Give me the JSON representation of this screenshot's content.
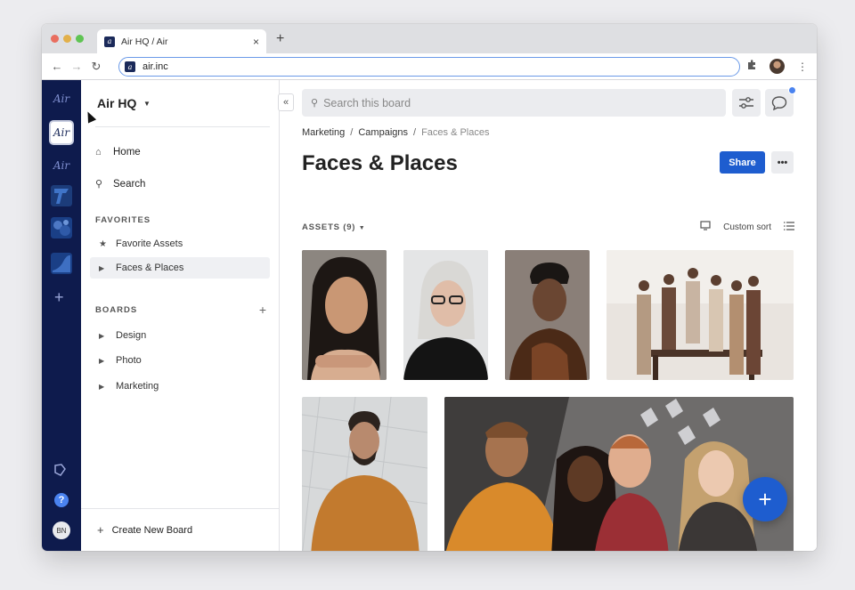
{
  "browser": {
    "tab_title": "Air HQ / Air",
    "tab_close": "×",
    "new_tab": "+",
    "url": "air.inc",
    "traffic_colors": [
      "#e96e5f",
      "#e2b04a",
      "#5fc453"
    ]
  },
  "rail": {
    "logo": "Air",
    "active_workspace": "Air",
    "workspace_2": "Air",
    "add": "+",
    "help": "?",
    "user_initials": "BN"
  },
  "sidebar": {
    "workspace_name": "Air HQ",
    "nav": [
      {
        "label": "Home",
        "icon": "home-icon"
      },
      {
        "label": "Search",
        "icon": "search-icon"
      }
    ],
    "favorites_header": "FAVORITES",
    "favorites": [
      {
        "label": "Favorite Assets",
        "icon": "star-icon"
      },
      {
        "label": "Faces & Places",
        "icon": "caret-right-icon",
        "selected": true
      }
    ],
    "boards_header": "BOARDS",
    "boards": [
      {
        "label": "Design"
      },
      {
        "label": "Photo"
      },
      {
        "label": "Marketing"
      }
    ],
    "create_board": "Create New Board"
  },
  "main": {
    "search_placeholder": "Search this board",
    "breadcrumbs": [
      "Marketing",
      "Campaigns",
      "Faces & Places"
    ],
    "breadcrumb_sep": "/",
    "title": "Faces & Places",
    "share_label": "Share",
    "more_label": "•••",
    "assets_label": "ASSETS (9)",
    "sort_label": "Custom sort",
    "accent": "#1e5dcf",
    "fab_label": "+"
  }
}
